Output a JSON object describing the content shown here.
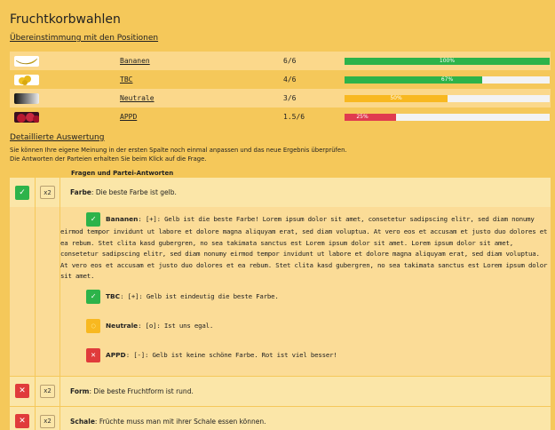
{
  "header": {
    "title": "Fruchtkorbwahlen",
    "subtitle": "Übereinstimmung mit den Positionen"
  },
  "results": [
    {
      "party": "Bananen",
      "score": "6/6",
      "percent": 100,
      "bar_label": "100%",
      "color": "#2db34a",
      "image": "banana-image"
    },
    {
      "party": "TBC",
      "score": "4/6",
      "percent": 67,
      "bar_label": "67%",
      "color": "#2db34a",
      "image": "lemons-image"
    },
    {
      "party": "Neutrale",
      "score": "3/6",
      "percent": 50,
      "bar_label": "50%",
      "color": "#f8b820",
      "image": "gradient-image"
    },
    {
      "party": "APPD",
      "score": "1.5/6",
      "percent": 25,
      "bar_label": "25%",
      "color": "#e03b4f",
      "image": "apples-image"
    }
  ],
  "detail": {
    "title": "Detaillierte Auswertung",
    "hint_line1": "Sie können Ihre eigene Meinung in der ersten Spalte noch einmal anpassen und das neue Ergebnis überprüfen.",
    "hint_line2": "Die Antworten der Parteien erhalten Sie beim Klick auf die Frage.",
    "column_header": "Fragen und Partei-Antworten"
  },
  "questions": [
    {
      "status": "check",
      "weight": "x2",
      "name": "Farbe",
      "text": ": Die beste Farbe ist gelb.",
      "answers": [
        {
          "party": "Bananen",
          "position": "[+]",
          "text": ": [+]: Gelb ist die beste Farbe! Lorem ipsum dolor sit amet, consetetur sadipscing elitr, sed diam nonumy eirmod tempor invidunt ut labore et dolore magna aliquyam erat, sed diam voluptua. At vero eos et accusam et justo duo dolores et ea rebum. Stet clita kasd gubergren, no sea takimata sanctus est Lorem ipsum dolor sit amet. Lorem ipsum dolor sit amet, consetetur sadipscing elitr, sed diam nonumy eirmod tempor invidunt ut labore et dolore magna aliquyam erat, sed diam voluptua. At vero eos et accusam et justo duo dolores et ea rebum. Stet clita kasd gubergren, no sea takimata sanctus est Lorem ipsum dolor sit amet."
        },
        {
          "party": "TBC",
          "position": "[+]",
          "text": ": [+]: Gelb ist eindeutig die beste Farbe."
        },
        {
          "party": "Neutrale",
          "position": "[o]",
          "text": ": [o]: Ist uns egal."
        },
        {
          "party": "APPD",
          "position": "[-]",
          "text": ": [-]: Gelb ist keine schöne Farbe. Rot ist viel besser!"
        }
      ]
    },
    {
      "status": "cross",
      "weight": "x2",
      "name": "Form",
      "text": ": Die beste Fruchtform ist rund."
    },
    {
      "status": "cross",
      "weight": "x2",
      "name": "Schale",
      "text": ": Früchte muss man mit ihrer Schale essen können."
    }
  ],
  "icons": {
    "check": "check-icon",
    "cross": "cross-icon",
    "neutral": "circle-icon"
  }
}
